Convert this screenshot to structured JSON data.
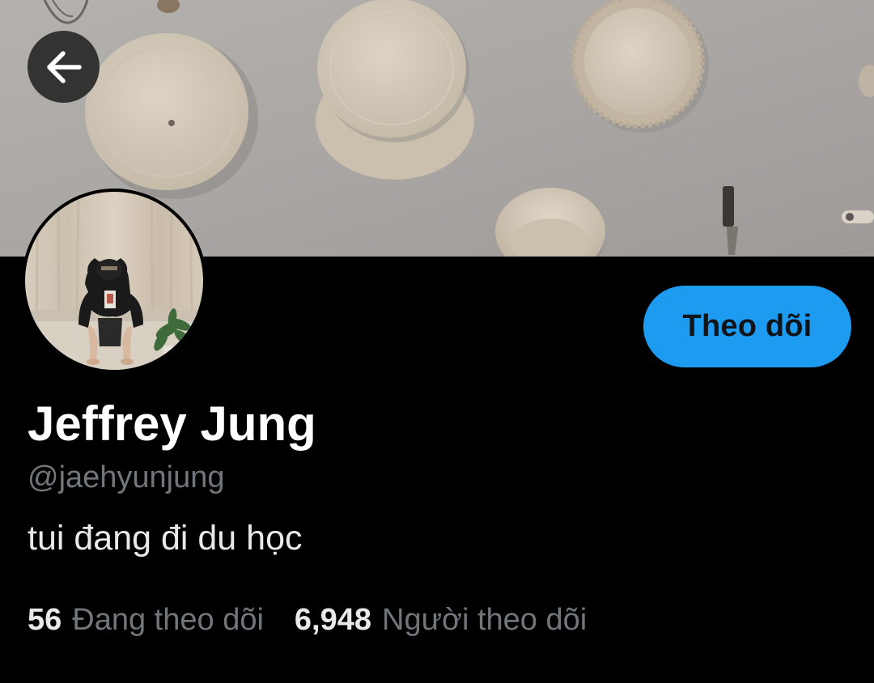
{
  "header": {
    "back_icon": "arrow-left-icon"
  },
  "banner": {
    "background_color": "#a7a4a3"
  },
  "profile": {
    "display_name": "Jeffrey Jung",
    "handle": "@jaehyunjung",
    "bio": "tui đang đi du học",
    "follow_label": "Theo dõi",
    "follow_color": "#1d9bf0"
  },
  "stats": {
    "following_count": "56",
    "following_label": "Đang theo dõi",
    "followers_count": "6,948",
    "followers_label": "Người theo dõi"
  }
}
